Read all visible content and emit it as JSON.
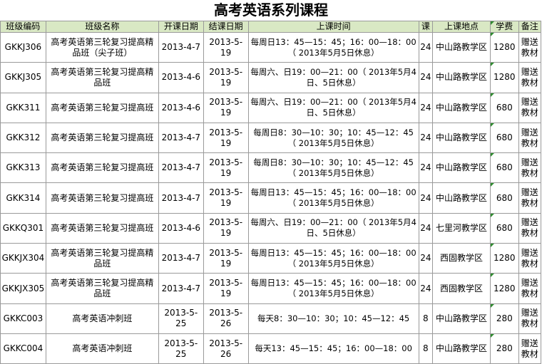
{
  "title": "高考英语系列课程",
  "colors": {
    "header_bg": "#d9e8c4",
    "grid": "#9a9a9a",
    "note_marker": "#2e8b2e"
  },
  "headers": [
    "班级编码",
    "班级名称",
    "开课日期",
    "结课日期",
    "上课时间",
    "课",
    "上课地点",
    "学费",
    "备注"
  ],
  "rows": [
    {
      "code": "GKKJ306",
      "name": "高考英语第三轮复习提高精品班（尖子班）",
      "start": "2013-4-7",
      "end": "2013-5-19",
      "time": "每周日13：45—15：45；16：00—18：00（ 2013年5月5日休息）",
      "lessons": "24",
      "location": "中山路教学区",
      "fee": "1280",
      "note": "赠送教材"
    },
    {
      "code": "GKKJ305",
      "name": "高考英语第三轮复习提高精品班",
      "start": "2013-4-6",
      "end": "2013-5-19",
      "time": "每周六、日19：00—21：00（ 2013年5月4日、5日休息）",
      "lessons": "24",
      "location": "中山路教学区",
      "fee": "1280",
      "note": "赠送教材"
    },
    {
      "code": "GKK311",
      "name": "高考英语第三轮复习提高班",
      "start": "2013-4-6",
      "end": "2013-5-19",
      "time": "每周六、日19：00—21：00（ 2013年5月4日、5日休息）",
      "lessons": "24",
      "location": "中山路教学区",
      "fee": "680",
      "note": "赠送教材"
    },
    {
      "code": "GKK312",
      "name": "高考英语第三轮复习提高班",
      "start": "2013-4-7",
      "end": "2013-5-19",
      "time": "每周日8：30—10：30；10：45—12：45（ 2013年5月5日休息）",
      "lessons": "24",
      "location": "中山路教学区",
      "fee": "680",
      "note": "赠送教材"
    },
    {
      "code": "GKK313",
      "name": "高考英语第三轮复习提高班",
      "start": "2013-4-7",
      "end": "2013-5-19",
      "time": "每周日8：30—10：30；10：45—12：45（ 2013年5月5日休息）",
      "lessons": "24",
      "location": "中山路教学区",
      "fee": "680",
      "note": "赠送教材"
    },
    {
      "code": "GKK314",
      "name": "高考英语第三轮复习提高班",
      "start": "2013-4-7",
      "end": "2013-5-19",
      "time": "每周日13：45—15：45；16：00—18：00（ 2013年5月5日休息）",
      "lessons": "24",
      "location": "中山路教学区",
      "fee": "680",
      "note": "赠送教材"
    },
    {
      "code": "GKKQ301",
      "name": "高考英语第三轮复习提高班",
      "start": "2013-4-6",
      "end": "2013-5-19",
      "time": "每周六、日19：00—21：00（ 2013年5月4日、5日休息）",
      "lessons": "24",
      "location": "七里河教学区",
      "fee": "680",
      "note": "赠送教材"
    },
    {
      "code": "GKKJX304",
      "name": "高考英语第三轮复习提高精品班",
      "start": "2013-4-7",
      "end": "2013-5-19",
      "time": "每周日13：45—15：45；16：00—18：00（ 2013年5月5日休息）",
      "lessons": "24",
      "location": "西固教学区",
      "fee": "1280",
      "note": "赠送教材"
    },
    {
      "code": "GKKJX305",
      "name": "高考英语第三轮复习提高精品班",
      "start": "2013-4-7",
      "end": "2013-5-19",
      "time": "每周日13：45—15：45；16：00—18：00（ 2013年5月5日休息）",
      "lessons": "24",
      "location": "西固教学区",
      "fee": "1280",
      "note": "赠送教材"
    },
    {
      "code": "GKKC003",
      "name": "高考英语冲刺班",
      "start": "2013-5-25",
      "end": "2013-5-26",
      "time": "每天8：30—10：30；10：45—12：45",
      "lessons": "8",
      "location": "中山路教学区",
      "fee": "280",
      "note": "赠送教材"
    },
    {
      "code": "GKKC004",
      "name": "高考英语冲刺班",
      "start": "2013-5-25",
      "end": "2013-5-26",
      "time": "每天13：45—15：45；16：00—18：00",
      "lessons": "8",
      "location": "中山路教学区",
      "fee": "280",
      "note": "赠送教材"
    }
  ]
}
